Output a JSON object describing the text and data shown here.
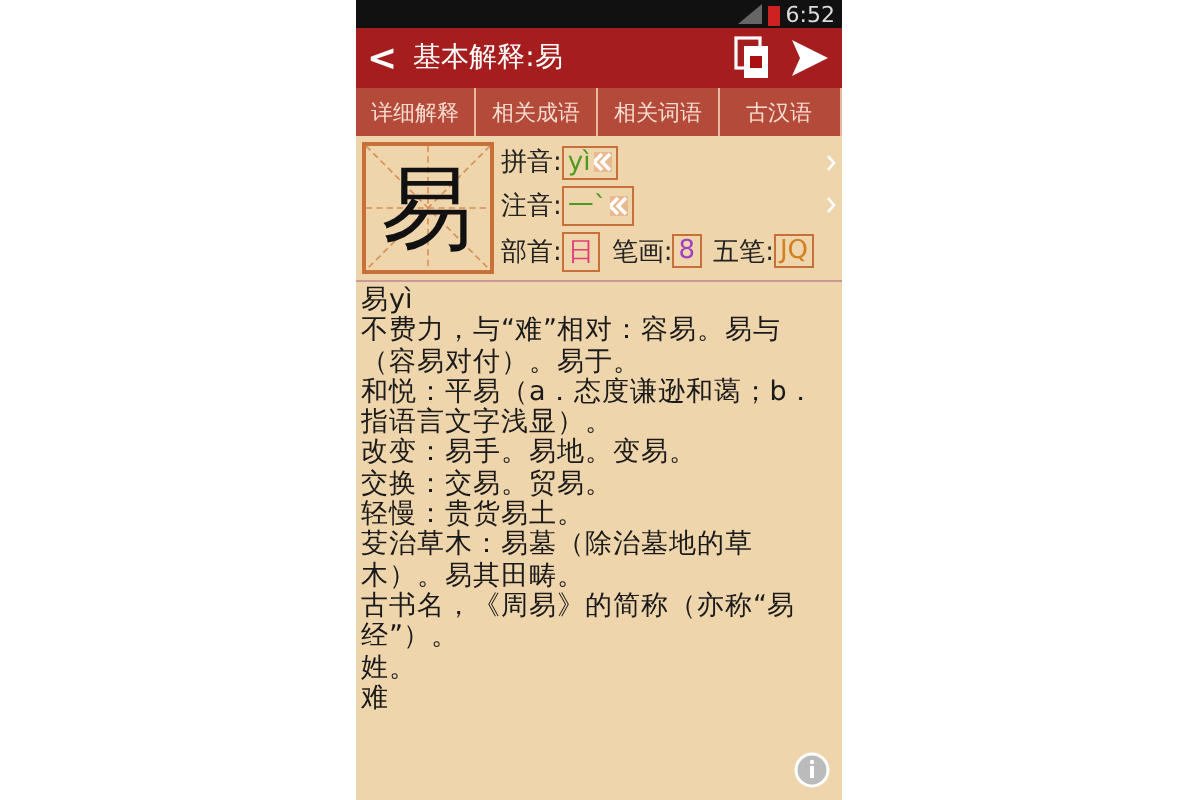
{
  "status_bar": {
    "time": "6:52"
  },
  "title_bar": {
    "back": "<",
    "title": "基本解释:易"
  },
  "tabs": [
    {
      "label": "详细解释",
      "selected": false
    },
    {
      "label": "相关成语",
      "selected": false
    },
    {
      "label": "相关词语",
      "selected": false
    },
    {
      "label": "古汉语",
      "selected": false
    }
  ],
  "character": "易",
  "pinyin": {
    "label": "拼音:",
    "value": "yì"
  },
  "zhuyin": {
    "label": "注音:",
    "value": "一ˋ"
  },
  "radical": {
    "label": "部首:",
    "value": "日"
  },
  "strokes": {
    "label": "笔画:",
    "value": "8"
  },
  "wubi": {
    "label": "五笔:",
    "value": "JQ"
  },
  "definitions": [
    "易yì",
    "不费力，与“难”相对：容易。易与（容易对付）。易于。",
    "和悦：平易（a．态度谦逊和蔼；b．指语言文字浅显）。",
    "改变：易手。易地。变易。",
    "交换：交易。贸易。",
    "轻慢：贵货易土。",
    "芟治草木：易墓（除治墓地的草木）。易其田畴。",
    "古书名，《周易》的简称（亦称“易经”）。",
    "姓。",
    "难"
  ]
}
